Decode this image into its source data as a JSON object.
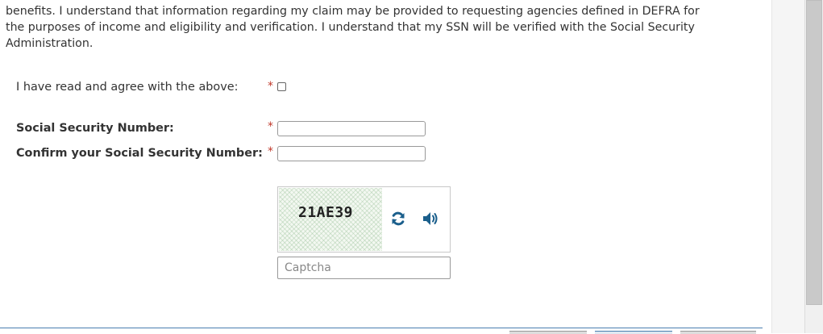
{
  "disclaimer": {
    "line1": "benefits. I understand that information regarding my claim may be provided to requesting agencies defined in DEFRA for",
    "line2": "the purposes of income and eligibility and verification. I understand that my SSN will be verified with the Social Security",
    "line3": "Administration."
  },
  "form": {
    "agree_label": "I have read and agree with the above:",
    "ssn_label": "Social Security Number:",
    "confirm_ssn_label": "Confirm your Social Security Number:",
    "required_marker": "*",
    "ssn_value": "",
    "confirm_ssn_value": ""
  },
  "captcha": {
    "code": "21AE39",
    "input_placeholder": "Captcha",
    "refresh_icon": "refresh-icon",
    "audio_icon": "speaker-icon",
    "icon_color": "#1b5f8c"
  },
  "colors": {
    "required": "#c0392b",
    "footer_border": "#4a7fb0"
  }
}
